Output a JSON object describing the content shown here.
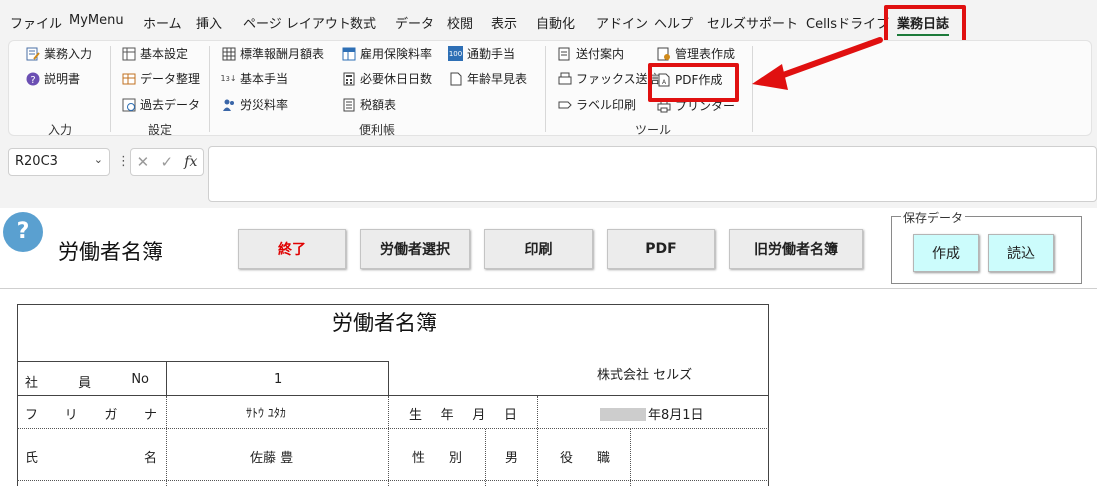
{
  "menu": {
    "tabs": [
      "ファイル",
      "MyMenu",
      "ホーム",
      "挿入",
      "ページ レイアウト",
      "数式",
      "データ",
      "校閲",
      "表示",
      "自動化",
      "アドイン",
      "ヘルプ",
      "セルズサポート",
      "Cellsドライブ",
      "業務日誌"
    ],
    "active_tab": "業務日誌"
  },
  "ribbon": {
    "input": {
      "label": "入力",
      "items": [
        "業務入力",
        "説明書"
      ]
    },
    "settings": {
      "label": "設定",
      "items": [
        "基本設定",
        "データ整理",
        "過去データ"
      ]
    },
    "handbook": {
      "label": "便利帳",
      "items": [
        "標準報酬月額表",
        "基本手当",
        "労災料率",
        "雇用保険料率",
        "必要休日日数",
        "税額表",
        "通勤手当",
        "年齢早見表"
      ]
    },
    "tools": {
      "label": "ツール",
      "items": [
        "送付案内",
        "ファックス送信",
        "ラベル印刷",
        "管理表作成",
        "PDF作成",
        "プリンター"
      ]
    }
  },
  "formula_bar": {
    "name_box": "R20C3",
    "formula": ""
  },
  "sheet": {
    "title": "労働者名簿",
    "buttons": [
      "終了",
      "労働者選択",
      "印刷",
      "PDF",
      "旧労働者名簿"
    ],
    "save_data": {
      "label": "保存データ",
      "create": "作成",
      "load": "読込"
    }
  },
  "register": {
    "title": "労働者名簿",
    "company": "株式会社 セルズ",
    "employee_no_label": "社 員 No",
    "employee_no": "1",
    "furigana_label": "フ リ ガ ナ",
    "furigana": "ｻﾄｳ ﾕﾀｶ",
    "birth_label": "生 年 月 日",
    "birth_value": "年8月1日",
    "name_label": "氏 名",
    "name": "佐藤 豊",
    "sex_label": "性 別",
    "sex": "男",
    "position_label": "役 職",
    "position": ""
  },
  "colors": {
    "highlight": "#e01010",
    "active_tab_underline": "#1d7a3a",
    "cyan_button": "#ccfcfc",
    "help_icon": "#5aa0d0"
  }
}
